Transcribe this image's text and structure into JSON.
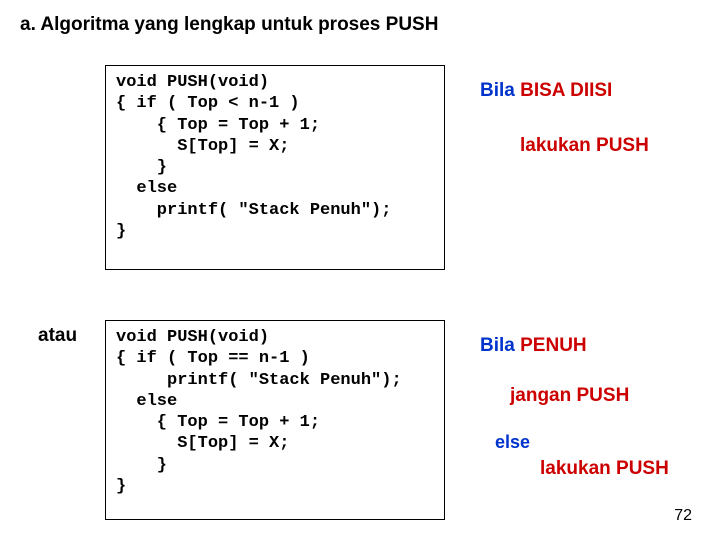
{
  "heading": "a.   Algoritma yang lengkap untuk proses PUSH",
  "code1": "void PUSH(void)\n{ if ( Top < n-1 )\n    { Top = Top + 1;\n      S[Top] = X;\n    }\n  else\n    printf( \"Stack Penuh\");\n}",
  "atau": "atau",
  "code2": "void PUSH(void)\n{ if ( Top == n-1 )\n     printf( \"Stack Penuh\");\n  else\n    { Top = Top + 1;\n      S[Top] = X;\n    }\n}",
  "note1_pre": "Bila ",
  "note1_em": "BISA DIISI",
  "note2": "lakukan PUSH",
  "note3_pre": "Bila ",
  "note3_em": "PENUH",
  "note4": "jangan PUSH",
  "note5": "else",
  "note6": "lakukan PUSH",
  "slide_num": "72"
}
